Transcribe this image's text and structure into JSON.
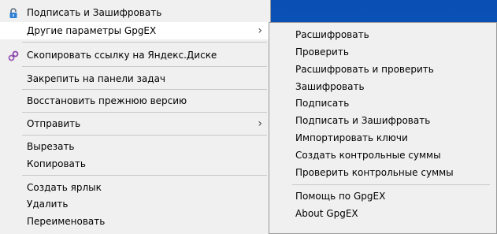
{
  "menu": {
    "items": [
      {
        "label": "Подписать и Зашифровать"
      },
      {
        "label": "Другие параметры GpgEX"
      },
      {
        "label": "Скопировать ссылку на Яндекс.Диске"
      },
      {
        "label": "Закрепить на панели задач"
      },
      {
        "label": "Восстановить прежнюю версию"
      },
      {
        "label": "Отправить"
      },
      {
        "label": "Вырезать"
      },
      {
        "label": "Копировать"
      },
      {
        "label": "Создать ярлык"
      },
      {
        "label": "Удалить"
      },
      {
        "label": "Переименовать"
      }
    ],
    "submenu_arrow": "›"
  },
  "submenu": {
    "items": [
      {
        "label": "Расшифровать"
      },
      {
        "label": "Проверить"
      },
      {
        "label": "Расшифровать и проверить"
      },
      {
        "label": "Зашифровать"
      },
      {
        "label": "Подписать"
      },
      {
        "label": "Подписать и Зашифровать"
      },
      {
        "label": "Импортировать ключи"
      },
      {
        "label": "Создать контрольные суммы"
      },
      {
        "label": "Проверить контрольные суммы"
      },
      {
        "label": "Помощь по GpgEX"
      },
      {
        "label": "About GpgEX"
      }
    ]
  },
  "icons": {
    "lock": "lock-icon",
    "link": "link-icon"
  },
  "colors": {
    "menu_bg": "#f0f0f0",
    "highlight": "#ffffff",
    "desktop": "#0b5bc7"
  }
}
